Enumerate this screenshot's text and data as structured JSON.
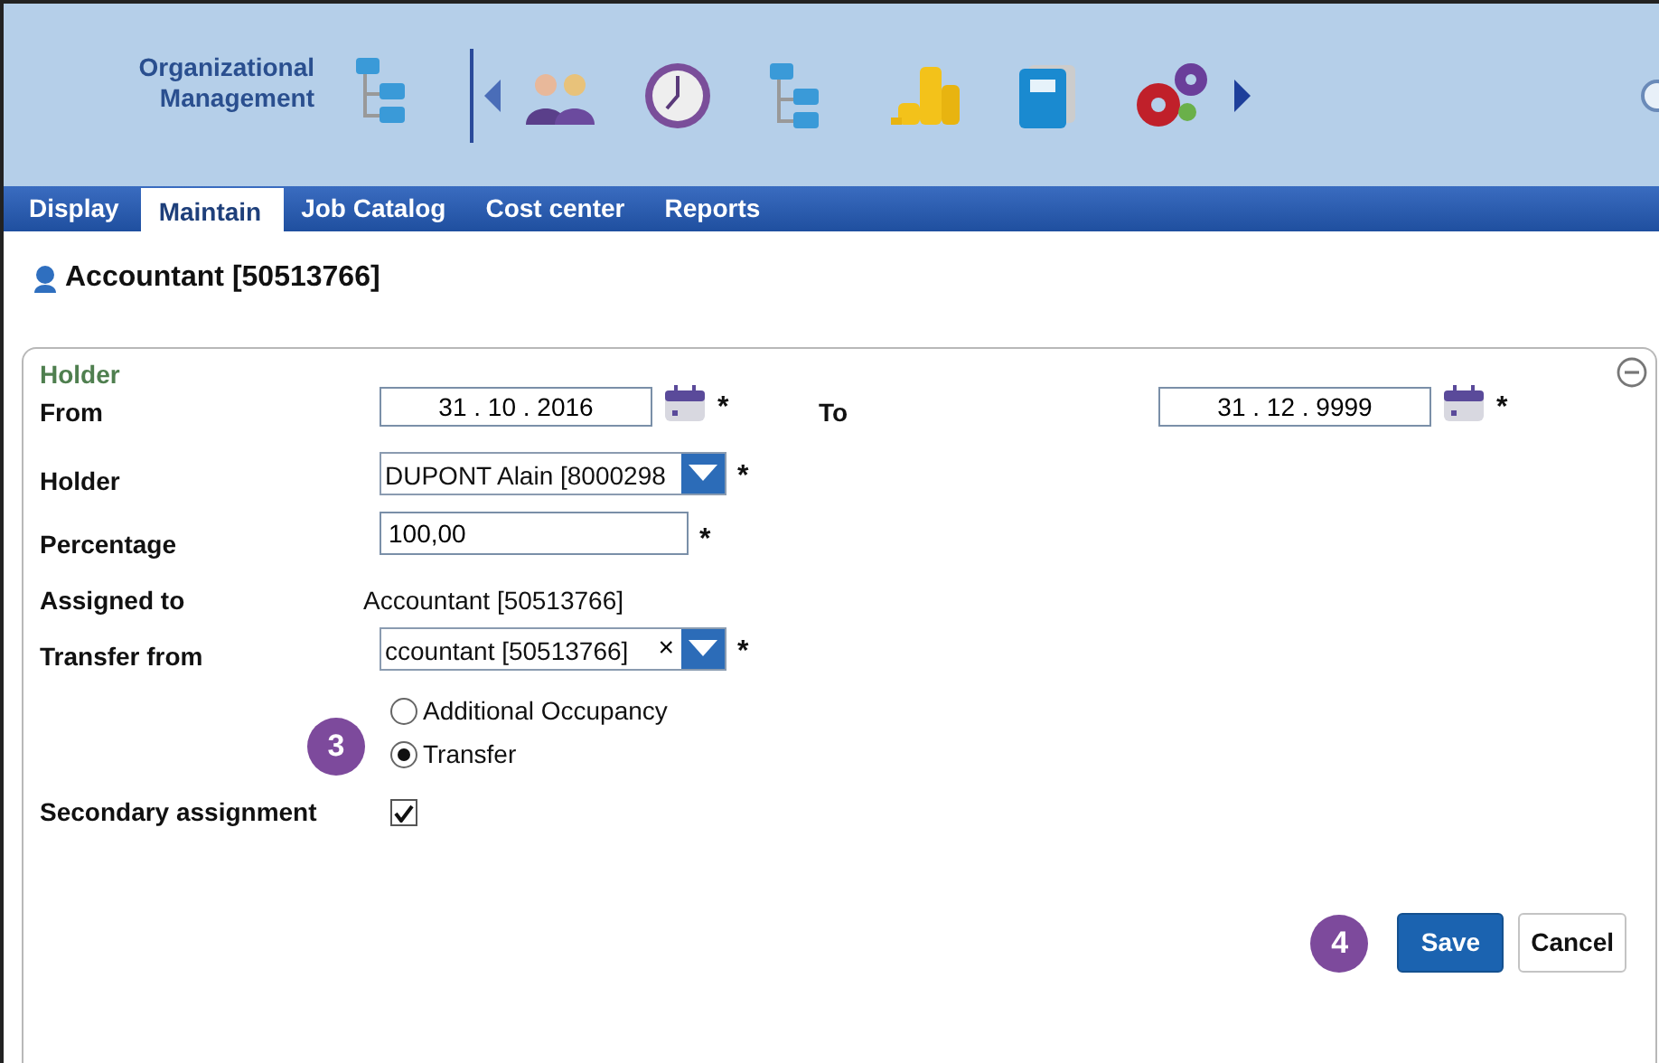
{
  "header": {
    "app_title": "Organizational Management"
  },
  "tabs": [
    {
      "label": "Display",
      "selected": false
    },
    {
      "label": "Maintain",
      "selected": true
    },
    {
      "label": "Job Catalog",
      "selected": false
    },
    {
      "label": "Cost center",
      "selected": false
    },
    {
      "label": "Reports",
      "selected": false
    }
  ],
  "page_title": "Accountant [50513766]",
  "panel": {
    "title": "Holder",
    "rows": [
      {
        "items": [
          {
            "kind": "date",
            "label": "From",
            "value": "31 . 10 . 2016",
            "required": "*"
          },
          {
            "kind": "date",
            "label": "To",
            "value": "31 . 12 . 9999",
            "required": "*"
          }
        ]
      },
      {
        "items": [
          {
            "kind": "combo",
            "label": "Holder",
            "value": "DUPONT Alain [8000298",
            "required": "*"
          }
        ]
      },
      {
        "items": [
          {
            "kind": "text",
            "label": "Percentage",
            "value": "100,00",
            "required": "*"
          }
        ]
      },
      {
        "items": [
          {
            "kind": "static",
            "label": "Assigned to",
            "value": "Accountant [50513766]"
          }
        ]
      },
      {
        "items": [
          {
            "kind": "combo",
            "label": "Transfer from",
            "value": "ccountant [50513766]",
            "clear": "×",
            "required": "*"
          }
        ]
      },
      {
        "items": [
          {
            "kind": "radio",
            "callout": "3",
            "options": [
              {
                "label": "Additional Occupancy",
                "selected": false
              },
              {
                "label": "Transfer",
                "selected": true
              }
            ]
          }
        ]
      },
      {
        "items": [
          {
            "kind": "checkbox",
            "label": "Secondary assignment",
            "checked": true
          }
        ]
      }
    ],
    "callout": "4",
    "buttons": [
      {
        "label": "Save",
        "kind": "primary"
      },
      {
        "label": "Cancel",
        "kind": "secondary"
      }
    ]
  }
}
